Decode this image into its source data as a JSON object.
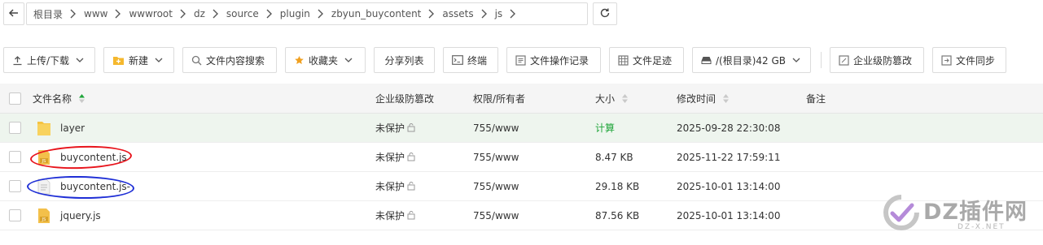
{
  "path": {
    "crumbs": [
      "根目录",
      "www",
      "wwwroot",
      "dz",
      "source",
      "plugin",
      "zbyun_buycontent",
      "assets",
      "js"
    ]
  },
  "toolbar": {
    "upload": "上传/下载",
    "new": "新建",
    "search": "文件内容搜索",
    "favorites": "收藏夹",
    "share_list": "分享列表",
    "terminal": "终端",
    "op_log": "文件操作记录",
    "footprint": "文件足迹",
    "disk": "/(根目录)42 GB",
    "tamper": "企业级防篡改",
    "sync": "文件同步"
  },
  "table": {
    "headers": {
      "name": "文件名称",
      "protection": "企业级防篡改",
      "permission": "权限/所有者",
      "size": "大小",
      "modified": "修改时间",
      "note": "备注"
    },
    "rows": [
      {
        "name": "layer",
        "protection": "未保护",
        "permission": "755/www",
        "size": "计算",
        "modified": "2025-09-28 22:30:08",
        "type": "folder"
      },
      {
        "name": "buycontent.js",
        "protection": "未保护",
        "permission": "755/www",
        "size": "8.47 KB",
        "modified": "2025-11-22 17:59:11",
        "type": "js"
      },
      {
        "name": "buycontent.js-",
        "protection": "未保护",
        "permission": "755/www",
        "size": "29.18 KB",
        "modified": "2025-10-01 13:14:00",
        "type": "file"
      },
      {
        "name": "jquery.js",
        "protection": "未保护",
        "permission": "755/www",
        "size": "87.56 KB",
        "modified": "2025-10-01 13:14:00",
        "type": "js"
      }
    ]
  },
  "watermark": {
    "text": "DZ插件网",
    "sub": "DZ-X.NET"
  },
  "colors": {
    "accent_green": "#20a53a",
    "folder": "#f5c342",
    "annotation_red": "#e8141c",
    "annotation_blue": "#1f2fd6"
  }
}
